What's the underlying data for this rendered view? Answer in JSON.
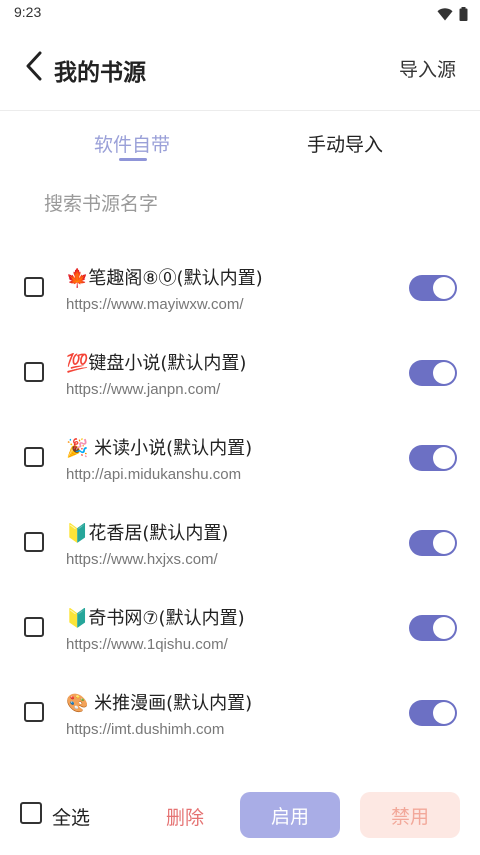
{
  "status_bar": {
    "time": "9:23",
    "icons": [
      "wifi-icon",
      "battery-icon"
    ]
  },
  "header": {
    "back_icon": "chevron-left-icon",
    "title": "我的书源",
    "import_label": "导入源"
  },
  "tabs": [
    {
      "label": "软件自带",
      "active": true
    },
    {
      "label": "手动导入",
      "active": false
    }
  ],
  "search": {
    "placeholder": "搜索书源名字",
    "value": ""
  },
  "sources": [
    {
      "name": "🍁笔趣阁⑧⓪(默认内置)",
      "url": "https://www.mayiwxw.com/",
      "checked": false,
      "enabled": true
    },
    {
      "name": "💯键盘小说(默认内置)",
      "url": "https://www.janpn.com/",
      "checked": false,
      "enabled": true
    },
    {
      "name": "🎉 米读小说(默认内置)",
      "url": "http://api.midukanshu.com",
      "checked": false,
      "enabled": true
    },
    {
      "name": "🔰花香居(默认内置)",
      "url": "https://www.hxjxs.com/",
      "checked": false,
      "enabled": true
    },
    {
      "name": "🔰奇书网⑦(默认内置)",
      "url": "https://www.1qishu.com/",
      "checked": false,
      "enabled": true
    },
    {
      "name": "🎨 米推漫画(默认内置)",
      "url": "https://imt.dushimh.com",
      "checked": false,
      "enabled": true
    }
  ],
  "bottom_bar": {
    "select_all_label": "全选",
    "delete_label": "删除",
    "enable_label": "启用",
    "disable_label": "禁用"
  },
  "colors": {
    "accent": "#6c70c4",
    "tab_active": "#9aa0d8",
    "enable_button": "#a9ade6",
    "disable_button_bg": "#fde8e3",
    "disable_button_text": "#f2a89a",
    "delete_text": "#e57373"
  }
}
